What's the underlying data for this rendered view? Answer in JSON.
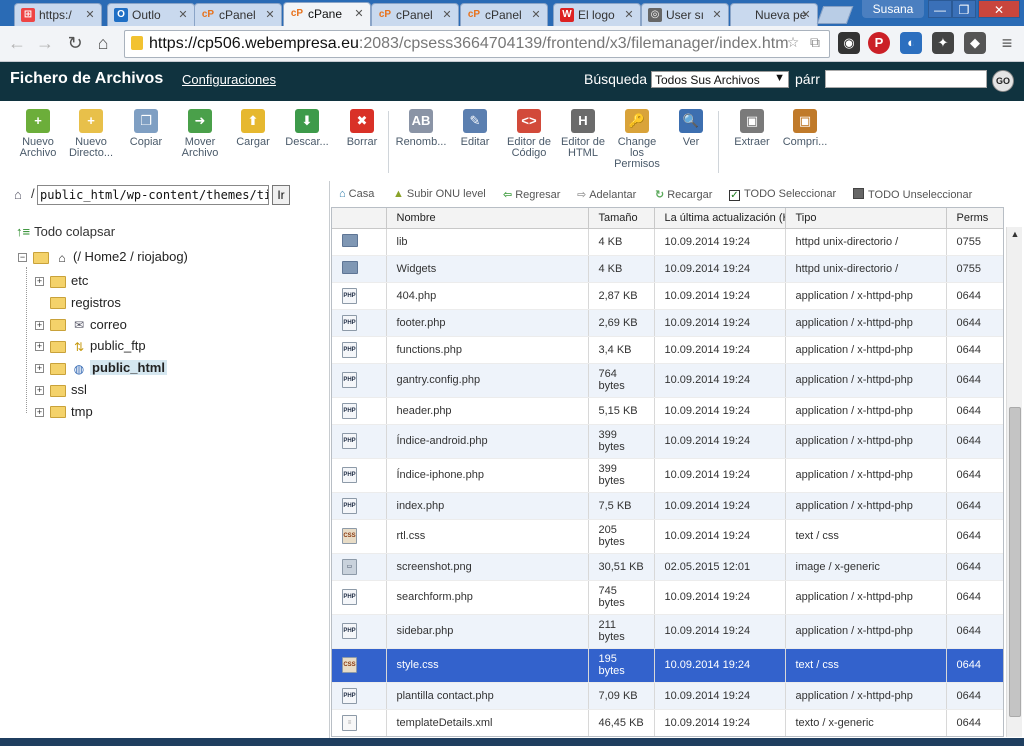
{
  "browser": {
    "tabs": [
      {
        "label": "https:/",
        "favicon": "windows-flag",
        "active": false
      },
      {
        "label": "Outlo",
        "favicon": "outlook",
        "active": false
      },
      {
        "label": "cPanel",
        "favicon": "cpanel",
        "active": false
      },
      {
        "label": "cPane",
        "favicon": "cpanel",
        "active": true
      },
      {
        "label": "cPanel",
        "favicon": "cpanel",
        "active": false
      },
      {
        "label": "cPanel",
        "favicon": "cpanel",
        "active": false
      },
      {
        "label": "El logo",
        "favicon": "wp",
        "active": false
      },
      {
        "label": "User sı",
        "favicon": "globe",
        "active": false
      },
      {
        "label": "Nueva pe",
        "favicon": "none",
        "active": false
      }
    ],
    "user": "Susana",
    "url_host": "https://cp506.webempresa.eu",
    "url_path": ":2083/cpsess3664704139/frontend/x3/filemanager/index.htm"
  },
  "header": {
    "title": "Fichero de Archivos",
    "settings": "Configuraciones",
    "search_label": "Búsqueda",
    "search_scope": "Todos Sus Archivos",
    "search_for": "párr",
    "go": "GO"
  },
  "actions": [
    {
      "label": "Nuevo Archivo",
      "icon": "new-file-icon",
      "color": "#6cae3a",
      "glyph": "+"
    },
    {
      "label": "Nuevo Directo...",
      "icon": "new-folder-icon",
      "color": "#e8c04a",
      "glyph": "+"
    },
    {
      "label": "Copiar",
      "icon": "copy-icon",
      "color": "#7f9fc3",
      "glyph": "❐"
    },
    {
      "label": "Mover Archivo",
      "icon": "move-icon",
      "color": "#4aa04a",
      "glyph": "➜"
    },
    {
      "label": "Cargar",
      "icon": "upload-icon",
      "color": "#e6b82f",
      "glyph": "⬆"
    },
    {
      "label": "Descar...",
      "icon": "download-icon",
      "color": "#3d9a4a",
      "glyph": "⬇"
    },
    {
      "label": "Borrar",
      "icon": "delete-icon",
      "color": "#d93127",
      "glyph": "✖"
    },
    {
      "label": "Renomb...",
      "icon": "rename-icon",
      "color": "#8a94a6",
      "glyph": "AB"
    },
    {
      "label": "Editar",
      "icon": "edit-icon",
      "color": "#5b7fb0",
      "glyph": "✎"
    },
    {
      "label": "Editor de Código",
      "icon": "code-editor-icon",
      "color": "#d24a3a",
      "glyph": "<>"
    },
    {
      "label": "Editor de HTML",
      "icon": "html-editor-icon",
      "color": "#6b6b6b",
      "glyph": "H"
    },
    {
      "label": "Change los Permisos",
      "icon": "permissions-icon",
      "color": "#d9a33a",
      "glyph": "🔑"
    },
    {
      "label": "Ver",
      "icon": "view-icon",
      "color": "#3d6fb0",
      "glyph": "🔍"
    },
    {
      "label": "Extraer",
      "icon": "extract-icon",
      "color": "#7a7a7a",
      "glyph": "▣"
    },
    {
      "label": "Compri...",
      "icon": "compress-icon",
      "color": "#c07a2a",
      "glyph": "▣"
    }
  ],
  "left": {
    "path": "public_html/wp-content/themes/titania_",
    "go": "Ir",
    "collapse": "Todo colapsar",
    "root": "(/ Home2 / riojabog)",
    "tree": [
      {
        "label": "etc",
        "expand": true,
        "icon": "folder-icon"
      },
      {
        "label": "registros",
        "expand": false,
        "icon": "folder-icon"
      },
      {
        "label": "correo",
        "expand": true,
        "icon": "mail-icon"
      },
      {
        "label": "public_ftp",
        "expand": true,
        "icon": "ftp-icon"
      },
      {
        "label": "public_html",
        "expand": true,
        "icon": "globe-icon",
        "selected": true
      },
      {
        "label": "ssl",
        "expand": true,
        "icon": "folder-icon"
      },
      {
        "label": "tmp",
        "expand": true,
        "icon": "folder-icon"
      }
    ]
  },
  "navbar": {
    "home": "Casa",
    "up": "Subir ONU level",
    "back": "Regresar",
    "forward": "Adelantar",
    "reload": "Recargar",
    "select_all": "TODO Seleccionar",
    "unselect_all": "TODO Unseleccionar"
  },
  "table": {
    "columns": [
      "Nombre",
      "Tamaño",
      "La última actualización (H",
      "Tipo",
      "Perms"
    ],
    "rows": [
      {
        "name": "lib",
        "size": "4 KB",
        "date": "10.09.2014 19:24",
        "type": "httpd unix-directorio /",
        "perms": "0755",
        "icon": "folder"
      },
      {
        "name": "Widgets",
        "size": "4 KB",
        "date": "10.09.2014 19:24",
        "type": "httpd unix-directorio /",
        "perms": "0755",
        "icon": "folder"
      },
      {
        "name": "404.php",
        "size": "2,87 KB",
        "date": "10.09.2014 19:24",
        "type": "application / x-httpd-php",
        "perms": "0644",
        "icon": "php"
      },
      {
        "name": "footer.php",
        "size": "2,69 KB",
        "date": "10.09.2014 19:24",
        "type": "application / x-httpd-php",
        "perms": "0644",
        "icon": "php"
      },
      {
        "name": "functions.php",
        "size": "3,4 KB",
        "date": "10.09.2014 19:24",
        "type": "application / x-httpd-php",
        "perms": "0644",
        "icon": "php"
      },
      {
        "name": "gantry.config.php",
        "size": "764 bytes",
        "date": "10.09.2014 19:24",
        "type": "application / x-httpd-php",
        "perms": "0644",
        "icon": "php"
      },
      {
        "name": "header.php",
        "size": "5,15 KB",
        "date": "10.09.2014 19:24",
        "type": "application / x-httpd-php",
        "perms": "0644",
        "icon": "php"
      },
      {
        "name": "Índice-android.php",
        "size": "399 bytes",
        "date": "10.09.2014 19:24",
        "type": "application / x-httpd-php",
        "perms": "0644",
        "icon": "php"
      },
      {
        "name": "Índice-iphone.php",
        "size": "399 bytes",
        "date": "10.09.2014 19:24",
        "type": "application / x-httpd-php",
        "perms": "0644",
        "icon": "php"
      },
      {
        "name": "index.php",
        "size": "7,5 KB",
        "date": "10.09.2014 19:24",
        "type": "application / x-httpd-php",
        "perms": "0644",
        "icon": "php"
      },
      {
        "name": "rtl.css",
        "size": "205 bytes",
        "date": "10.09.2014 19:24",
        "type": "text / css",
        "perms": "0644",
        "icon": "css"
      },
      {
        "name": "screenshot.png",
        "size": "30,51 KB",
        "date": "02.05.2015 12:01",
        "type": "image / x-generic",
        "perms": "0644",
        "icon": "png"
      },
      {
        "name": "searchform.php",
        "size": "745 bytes",
        "date": "10.09.2014 19:24",
        "type": "application / x-httpd-php",
        "perms": "0644",
        "icon": "php"
      },
      {
        "name": "sidebar.php",
        "size": "211 bytes",
        "date": "10.09.2014 19:24",
        "type": "application / x-httpd-php",
        "perms": "0644",
        "icon": "php"
      },
      {
        "name": "style.css",
        "size": "195 bytes",
        "date": "10.09.2014 19:24",
        "type": "text / css",
        "perms": "0644",
        "icon": "css",
        "selected": true
      },
      {
        "name": "plantilla contact.php",
        "size": "7,09 KB",
        "date": "10.09.2014 19:24",
        "type": "application / x-httpd-php",
        "perms": "0644",
        "icon": "php"
      },
      {
        "name": "templateDetails.xml",
        "size": "46,45 KB",
        "date": "10.09.2014 19:24",
        "type": "texto / x-generic",
        "perms": "0644",
        "icon": "xml"
      }
    ]
  },
  "colors": {
    "header_bg": "#10333f",
    "selection": "#3362cc",
    "alt_row": "#eef3fa"
  }
}
